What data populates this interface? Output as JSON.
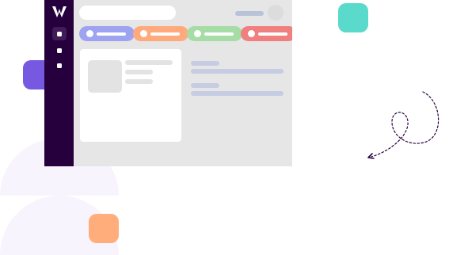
{
  "illustration": {
    "kind": "app-window-mockup-placeholder",
    "colors": {
      "sidebar": "#26003d",
      "purple_square": "#7758e0",
      "teal_square": "#5adacb",
      "orange_square": "#ffad7a",
      "tab_blue": "#9da3f1",
      "tab_orange": "#ffaa7c",
      "tab_green": "#a6dca6",
      "tab_red": "#f07f80",
      "window_background": "#e6e6e6",
      "blob": "#f8f4fd"
    },
    "icons": {
      "logo": "w-logo-icon",
      "arrow": "dashed-loop-arrow-icon"
    },
    "sidebar_nav_item_count": 3,
    "tab_count": 4
  }
}
